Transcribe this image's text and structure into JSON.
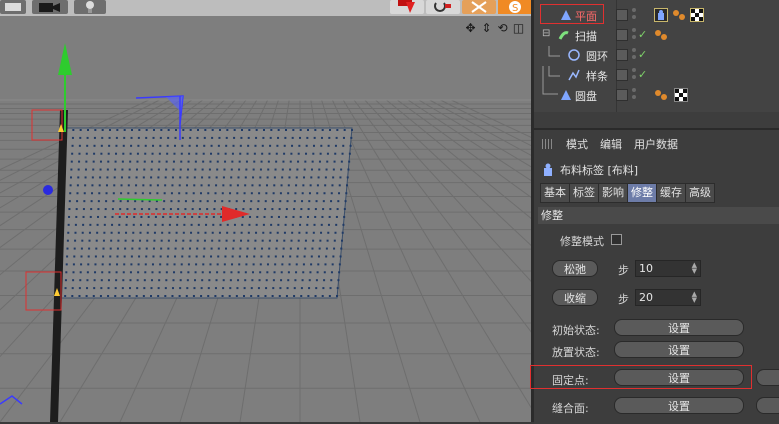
{
  "viewport": {
    "nav_icons": [
      "move-view-icon",
      "zoom-view-icon",
      "rotate-view-icon",
      "maximize-view-icon"
    ]
  },
  "object_manager": {
    "objects": [
      {
        "name": "平面",
        "icon": "plane-icon",
        "selected": true,
        "tags": [
          "cloth-tag-icon",
          "material-dots-icon",
          "checker-material-icon"
        ]
      },
      {
        "name": "扫描",
        "icon": "sweep-icon",
        "checked": true,
        "tags": [
          "material-dots-icon"
        ]
      },
      {
        "name": "圆环",
        "icon": "circle-spline-icon",
        "checked": true
      },
      {
        "name": "样条",
        "icon": "spline-icon",
        "checked": true
      },
      {
        "name": "圆盘",
        "icon": "disc-icon",
        "tags": [
          "material-dots-icon",
          "checker-material-icon"
        ]
      }
    ]
  },
  "attributes": {
    "menu": [
      "模式",
      "编辑",
      "用户数据"
    ],
    "tag_title": "布料标签 [布料]",
    "tabs": [
      "基本",
      "标签",
      "影响",
      "修整",
      "缓存",
      "高级"
    ],
    "active_tab": "修整",
    "section": "修整",
    "dress_mode_label": "修整模式",
    "relax_button": "松弛",
    "relax_step_label": "步",
    "relax_steps": "10",
    "shrink_button": "收缩",
    "shrink_step_label": "步",
    "shrink_steps": "20",
    "init_state_label": "初始状态:",
    "init_state_button": "设置",
    "dress_state_label": "放置状态:",
    "dress_state_button": "设置",
    "fix_points_label": "固定点:",
    "fix_points_button": "设置",
    "seam_label": "缝合面:",
    "seam_button": "设置"
  },
  "colors": {
    "viewport_bg": "#7e7e7e",
    "accent_tab": "#6d7ca8",
    "highlight_box": "#e03030",
    "axis_y": "#2ecc2e",
    "axis_x": "#e02a2a",
    "axis_z": "#2a2ae0"
  }
}
